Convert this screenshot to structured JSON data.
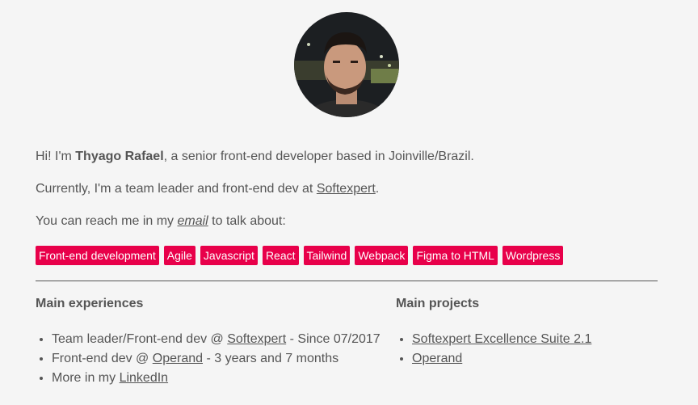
{
  "profile": {
    "avatar_alt": "Thyago Rafael",
    "intro_prefix": "Hi! I'm ",
    "name": "Thyago Rafael",
    "intro_suffix": ", a senior front-end developer based in Joinville/Brazil.",
    "current_prefix": "Currently, I'm a team leader and front-end dev at ",
    "current_company": "Softexpert",
    "current_suffix": ".",
    "reach_prefix": "You can reach me in my ",
    "reach_link": "email",
    "reach_suffix": " to talk about:"
  },
  "tags": [
    "Front-end development",
    "Agile",
    "Javascript",
    "React",
    "Tailwind",
    "Webpack",
    "Figma to HTML",
    "Wordpress"
  ],
  "experiences": {
    "title": "Main experiences",
    "items": [
      {
        "prefix": "Team leader/Front-end dev @ ",
        "link": "Softexpert",
        "suffix": " - Since 07/2017"
      },
      {
        "prefix": "Front-end dev @ ",
        "link": "Operand",
        "suffix": " - 3 years and 7 months"
      },
      {
        "prefix": "More in my ",
        "link": "LinkedIn",
        "suffix": ""
      }
    ]
  },
  "projects": {
    "title": "Main projects",
    "items": [
      {
        "link": "Softexpert Excellence Suite 2.1"
      },
      {
        "link": "Operand"
      }
    ]
  },
  "colors": {
    "tag_background": "#e8004a",
    "tag_text": "#ffffff",
    "text": "#555555",
    "background": "#f5f5f5"
  }
}
